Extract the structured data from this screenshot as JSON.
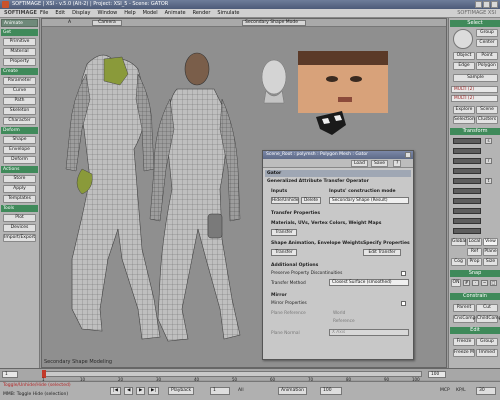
{
  "title_bar": {
    "title": "SOFTIMAGE | XSI - v.5.0 (Alt-2) | Project: XSI_5 - Scene: GATOR"
  },
  "menu": {
    "logo": "SOFTIMAGE",
    "items": [
      "File",
      "Edit",
      "Display",
      "Window",
      "Help",
      "Model",
      "Animate",
      "Render",
      "Simulate"
    ],
    "right_label": "SOFTIMAGE XSI"
  },
  "left_panel": {
    "mode": "Animate",
    "sections": [
      {
        "label": "Get",
        "buttons": [
          "Primitive",
          "Material",
          "Property"
        ]
      },
      {
        "label": "Create",
        "buttons": [
          "Parameter",
          "Curve",
          "Path",
          "Skeleton",
          "Character"
        ]
      },
      {
        "label": "Deform",
        "buttons": [
          "Shape",
          "Envelope",
          "Deform"
        ]
      },
      {
        "label": "Actions",
        "buttons": [
          "Store",
          "Apply",
          "Templates"
        ]
      },
      {
        "label": "Tools",
        "buttons": [
          "Plot",
          "Devices",
          "Import/Export"
        ]
      }
    ]
  },
  "viewport": {
    "label": "A",
    "camera": "Camera",
    "display_mode": "Secondary Shape Mode",
    "footer": "Secondary Shape Modeling"
  },
  "dialog": {
    "title": "Scene_Root : polymsh : Polygon Mesh : Gator",
    "toolbar": {
      "load": "Load",
      "save": "Save"
    },
    "section": "Gator",
    "op_title": "Generalized Attribute Transfer Operator",
    "inputs": {
      "title": "Inputs",
      "hide_unhide": "Hide/Unhide",
      "delete": "Delete",
      "mode_title": "Inputs' construction mode",
      "mode_value": "Secondary Shape (Result)"
    },
    "transfer_properties": {
      "title": "Transfer Properties",
      "materials_title": "Materials, UVs, Vertex Colors, Weight Maps",
      "transfer": "Transfer",
      "shape_title": "Shape Animation, Envelope Weights",
      "transfer2": "Transfer",
      "specify_title": "Specify Properties",
      "edit_transfer": "Edit Transfer"
    },
    "additional": {
      "title": "Additional Options",
      "preserve": "Preserve Property Discontinuities",
      "transfer_method": "Transfer Method",
      "transfer_method_value": "Closest Surface (smoothed)"
    },
    "mirror": {
      "title": "Mirror",
      "mirror_properties": "Mirror Properties",
      "plane_reference": "Plane Reference",
      "world": "World",
      "reference": "Reference",
      "plane_normal": "Plane Normal",
      "plane_normal_value": "X Axis"
    }
  },
  "right_panel": {
    "select_label": "Select",
    "buttons_top": [
      "Group",
      "Center",
      "Object",
      "Point",
      "Edge",
      "Polygon",
      "Sample"
    ],
    "fields": [
      "MULTI (2)",
      "MULTI (2)"
    ],
    "buttons_mid": [
      "Explore",
      "Scene",
      "Selection",
      "Clusters"
    ],
    "transform_label": "Transform",
    "coord_modes": [
      "Global",
      "Local",
      "View"
    ],
    "plane_buttons": [
      "Ref",
      "Plane"
    ],
    "cog_buttons": [
      "Cog",
      "Prop",
      "Size"
    ],
    "snap_label": "Snap",
    "snap_on": "ON",
    "constrain_label": "Constrain",
    "constrain_buttons": [
      "Parent",
      "Cut",
      "CnsComp",
      "ChildComp"
    ],
    "edit_label": "Edit",
    "edit_buttons": [
      "Freeze",
      "Group",
      "Freeze M",
      "Immed"
    ]
  },
  "timeline": {
    "start": "1",
    "end": "100",
    "ticks": [
      "1",
      "10",
      "20",
      "30",
      "40",
      "50",
      "60",
      "70",
      "80",
      "90",
      "100"
    ],
    "current": "1",
    "range_end": "100"
  },
  "statusbar": {
    "message": "Toggle/Unhide/Hide (selected)",
    "sub_message": "MMB: Toggle Hide (selection)",
    "playback": "Playback",
    "all": "All",
    "animation": "Animation",
    "frame": "100",
    "fps_label": "MCP",
    "kp": "KP/L",
    "fps": "30"
  }
}
